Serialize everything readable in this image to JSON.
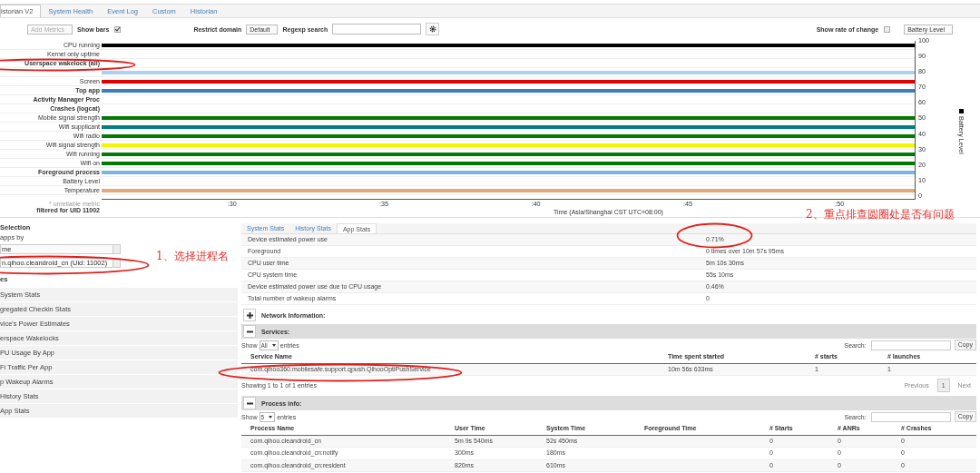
{
  "nav_tabs": [
    {
      "label": "istorian V2",
      "selected": true
    },
    {
      "label": "System Health",
      "selected": false
    },
    {
      "label": "Event Log",
      "selected": false
    },
    {
      "label": "Custom",
      "selected": false
    },
    {
      "label": "Historian",
      "selected": false
    }
  ],
  "toolbar": {
    "add_metrics": {
      "label": "Add Metrics",
      "disabled": true
    },
    "show_bars": {
      "label": "Show bars",
      "checked": true
    },
    "restrict_domain": {
      "label": "Restrict domain",
      "value": "Default"
    },
    "regexp_search": {
      "label": "Regexp search"
    },
    "show_rate": {
      "label": "Show rate of change",
      "checked": false
    },
    "metric_select": {
      "value": "Battery Level"
    }
  },
  "timeline": {
    "rows": [
      {
        "label": "CPU running",
        "bold": false,
        "color": "#000000"
      },
      {
        "label": "Kernel only uptime",
        "bold": false
      },
      {
        "label": "Userspace wakelock (all)",
        "bold": true
      },
      {
        "color": "#a9d3ef"
      },
      {
        "label": "Screen",
        "bold": false,
        "color": "#e00000"
      },
      {
        "label": "Top app",
        "bold": true,
        "color": "#3b7dbd"
      },
      {
        "label": "Activity Manager Proc",
        "bold": true
      },
      {
        "label": "Crashes (logcat)",
        "bold": true
      },
      {
        "label": "Mobile signal strength",
        "bold": false,
        "color": "#007a00"
      },
      {
        "label": "Wifi supplicant",
        "bold": false,
        "color": "#008080"
      },
      {
        "label": "Wifi radio",
        "bold": false,
        "color": "#007a00"
      },
      {
        "label": "Wifi signal strength",
        "bold": false,
        "color": "#f5f500"
      },
      {
        "label": "Wifi running",
        "bold": false,
        "color": "#007a00"
      },
      {
        "label": "Wifi on",
        "bold": false,
        "color": "#007a00"
      },
      {
        "label": "Foreground process",
        "bold": true,
        "color": "#7cb4de"
      },
      {
        "label": "Battery Level",
        "bold": false
      },
      {
        "label": "Temperature",
        "bold": false,
        "color": "#e5a97a"
      }
    ],
    "x_ticks": [
      ":30",
      ":35",
      ":40",
      ":45",
      ":50"
    ],
    "y_ticks": [
      "100",
      "90",
      "80",
      "70",
      "60",
      "50",
      "40",
      "30",
      "20",
      "10",
      "0"
    ],
    "x_label": "Time (Asia/Shanghai CST UTC+08:00)",
    "y_label": "Battery Level",
    "note": "* unreliable metric",
    "filter": "filtered for UID 11002"
  },
  "selection": {
    "title": "Selection",
    "sort_label": "apps by",
    "sort_value": "me",
    "app_value": "n.qihoo.cleandroid_cn (Uid: 11002)",
    "section": "es",
    "items": [
      "System Stats",
      "gregated Checkin Stats",
      "vice's Power Estimates",
      "erspace Wakelocks",
      "PU Usage By App",
      "Fi Traffic Per App",
      "p Wakeup Alarms",
      "History Stats",
      "App Stats"
    ]
  },
  "stats_tabs": [
    {
      "label": "System Stats",
      "selected": false
    },
    {
      "label": "History Stats",
      "selected": false
    },
    {
      "label": "App Stats",
      "selected": true
    }
  ],
  "app_stats": [
    {
      "label": "Device estimated power use",
      "value": "0.71%"
    },
    {
      "label": "Foreground",
      "value": "0 times over 10m 57s 95ms"
    },
    {
      "label": "CPU user time",
      "value": "5m 10s 30ms"
    },
    {
      "label": "CPU system time",
      "value": "55s 10ms"
    },
    {
      "label": "Device estimated power use due to CPU usage",
      "value": "0.46%"
    },
    {
      "label": "Total number of wakeup alarms",
      "value": "0"
    }
  ],
  "network": {
    "title": "Network Information:",
    "expanded": false
  },
  "services": {
    "title": "Services:",
    "expanded": true,
    "show": "Show",
    "show_value": "All",
    "entries": "entries",
    "search": "Search:",
    "copy": "Copy",
    "columns": [
      "Service Name",
      "Time spent started",
      "# starts",
      "# launches"
    ],
    "rows": [
      [
        "com.qihoo360.mobilesafe.support.qpush.QihooOptiPushService",
        "10m 56s 633ms",
        "1",
        "1"
      ]
    ],
    "info": "Showing 1 to 1 of 1 entries",
    "previous": "Previous",
    "page": "1",
    "next": "Next"
  },
  "processes": {
    "title": "Process info:",
    "expanded": true,
    "show": "Show",
    "show_value": "5",
    "entries": "entries",
    "search": "Search:",
    "copy": "Copy",
    "columns": [
      "Process Name",
      "User Time",
      "System Time",
      "Foreground Time",
      "# Starts",
      "# ANRs",
      "# Crashes"
    ],
    "rows": [
      {
        "name": "com.qihoo.cleandroid_cn",
        "user_time": "5m 9s 540ms",
        "system_time": "52s 450ms",
        "starts": "0",
        "anrs": "0",
        "crashes": "0"
      },
      {
        "name": "com.qihoo.cleandroid_cn:notify",
        "user_time": "300ms",
        "system_time": "180ms",
        "starts": "0",
        "anrs": "0",
        "crashes": "0"
      },
      {
        "name": "com.qihoo.cleandroid_cn:resident",
        "user_time": "820ms",
        "system_time": "610ms",
        "starts": "0",
        "anrs": "0",
        "crashes": "0"
      }
    ]
  },
  "annotations": {
    "notes": [
      "1、选择进程名",
      "2、重点排查圆圈处是否有问题"
    ],
    "circles": [
      {
        "kind": "ellipse"
      },
      {
        "kind": "ellipse"
      },
      {
        "kind": "ellipse"
      },
      {
        "kind": "ellipse"
      }
    ]
  }
}
